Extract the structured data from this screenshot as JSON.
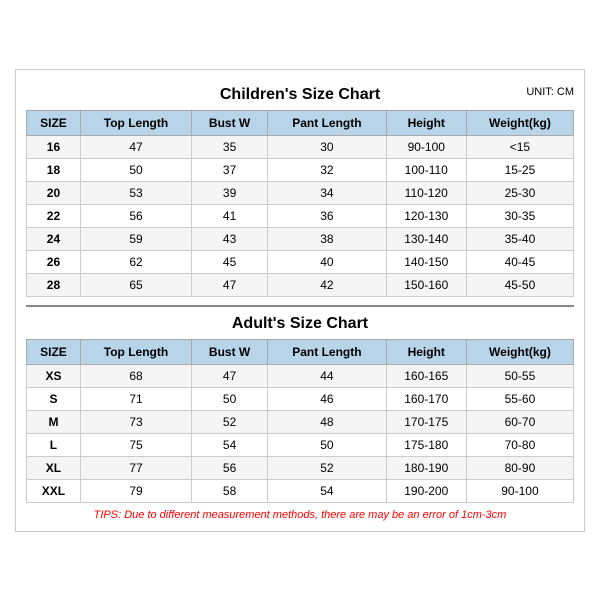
{
  "page": {
    "main_title": "Children's Size Chart",
    "unit": "UNIT: CM",
    "children_headers": [
      "SIZE",
      "Top Length",
      "Bust W",
      "Pant Length",
      "Height",
      "Weight(kg)"
    ],
    "children_rows": [
      [
        "16",
        "47",
        "35",
        "30",
        "90-100",
        "<15"
      ],
      [
        "18",
        "50",
        "37",
        "32",
        "100-110",
        "15-25"
      ],
      [
        "20",
        "53",
        "39",
        "34",
        "110-120",
        "25-30"
      ],
      [
        "22",
        "56",
        "41",
        "36",
        "120-130",
        "30-35"
      ],
      [
        "24",
        "59",
        "43",
        "38",
        "130-140",
        "35-40"
      ],
      [
        "26",
        "62",
        "45",
        "40",
        "140-150",
        "40-45"
      ],
      [
        "28",
        "65",
        "47",
        "42",
        "150-160",
        "45-50"
      ]
    ],
    "adults_title": "Adult's Size Chart",
    "adults_headers": [
      "SIZE",
      "Top Length",
      "Bust W",
      "Pant Length",
      "Height",
      "Weight(kg)"
    ],
    "adults_rows": [
      [
        "XS",
        "68",
        "47",
        "44",
        "160-165",
        "50-55"
      ],
      [
        "S",
        "71",
        "50",
        "46",
        "160-170",
        "55-60"
      ],
      [
        "M",
        "73",
        "52",
        "48",
        "170-175",
        "60-70"
      ],
      [
        "L",
        "75",
        "54",
        "50",
        "175-180",
        "70-80"
      ],
      [
        "XL",
        "77",
        "56",
        "52",
        "180-190",
        "80-90"
      ],
      [
        "XXL",
        "79",
        "58",
        "54",
        "190-200",
        "90-100"
      ]
    ],
    "tips": "TIPS: Due to different measurement methods, there are may be an error of 1cm-3cm"
  }
}
